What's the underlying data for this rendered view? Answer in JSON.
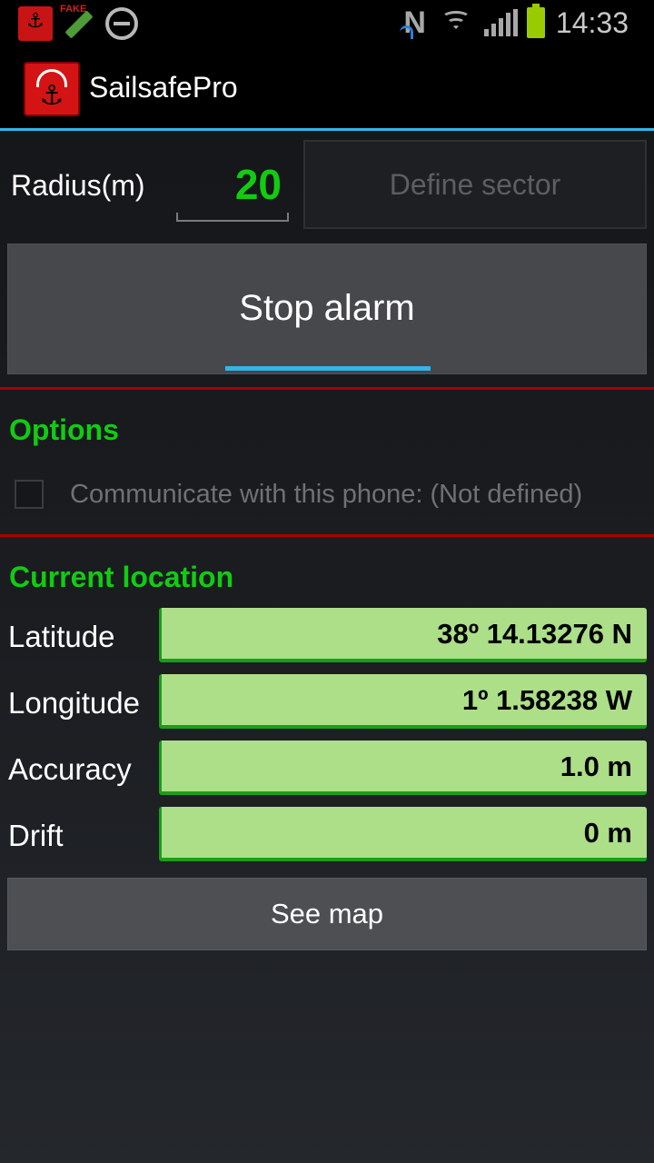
{
  "status_bar": {
    "clock": "14:33",
    "icons": [
      "sailsafe-notification-icon",
      "fake-gps-icon",
      "do-not-disturb-icon",
      "nfc-icon",
      "wifi-icon",
      "signal-icon",
      "battery-icon"
    ],
    "fake_gps_label": "FAKE"
  },
  "action_bar": {
    "title": "SailsafePro",
    "icon": "anchor-icon"
  },
  "radius": {
    "label": "Radius(m)",
    "value": "20"
  },
  "define_sector_label": "Define sector",
  "stop_alarm_label": "Stop alarm",
  "options": {
    "title": "Options",
    "communicate_label": "Communicate with this phone: (Not defined)",
    "communicate_checked": false
  },
  "location": {
    "title": "Current location",
    "rows": [
      {
        "label": "Latitude",
        "value": "38º 14.13276 N"
      },
      {
        "label": "Longitude",
        "value": "1º 1.58238 W"
      },
      {
        "label": "Accuracy",
        "value": "1.0 m"
      },
      {
        "label": "Drift",
        "value": "0 m"
      }
    ]
  },
  "see_map_label": "See map",
  "colors": {
    "accent_blue": "#33b5e5",
    "section_green": "#11cc11",
    "divider_red": "#a80000",
    "value_bg": "#acdf88"
  }
}
